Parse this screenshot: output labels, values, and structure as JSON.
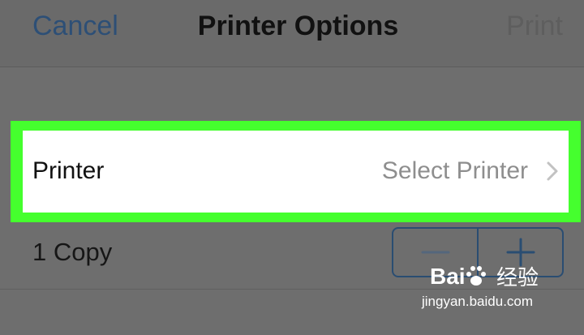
{
  "navbar": {
    "cancel_label": "Cancel",
    "title": "Printer Options",
    "print_label": "Print"
  },
  "printer_row": {
    "label": "Printer",
    "value": "Select Printer",
    "highlight_color": "#45ff2e"
  },
  "copies": {
    "label": "1 Copy",
    "decrement_icon": "minus-icon",
    "increment_icon": "plus-icon"
  },
  "watermark": {
    "logo": "Bai",
    "chinese": "经验",
    "url": "jingyan.baidu.com"
  },
  "colors": {
    "accent": "#2d4f76",
    "disabled": "#5e5e5e",
    "overlay_background": "#6e6e6e"
  }
}
